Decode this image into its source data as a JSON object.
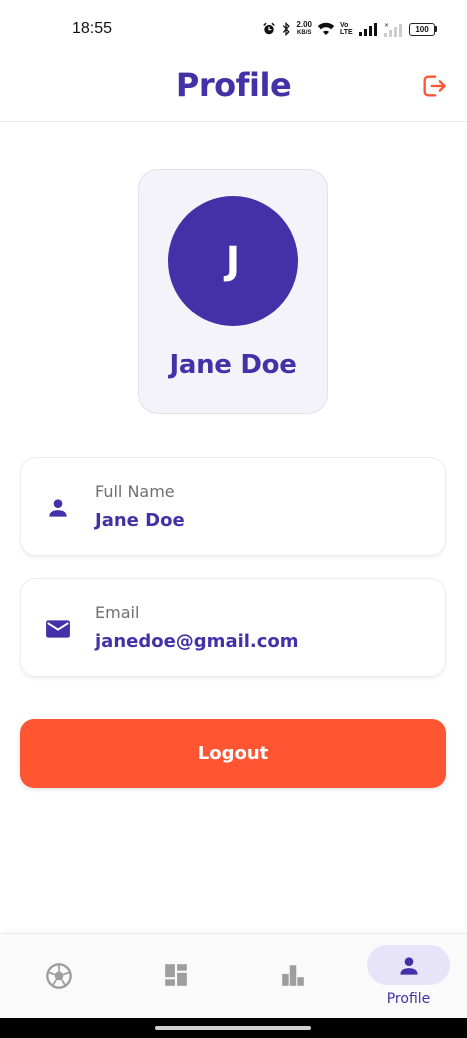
{
  "status_bar": {
    "time": "18:55",
    "net_speed": "2.00",
    "net_unit": "KB/S",
    "volte": "Vo LTE",
    "battery": "100"
  },
  "app_bar": {
    "title": "Profile"
  },
  "profile": {
    "initial": "J",
    "name": "Jane Doe"
  },
  "fields": {
    "full_name": {
      "label": "Full Name",
      "value": "Jane Doe",
      "icon": "person-icon"
    },
    "email": {
      "label": "Email",
      "value": "janedoe@gmail.com",
      "icon": "mail-icon"
    }
  },
  "logout_button": {
    "label": "Logout"
  },
  "bottom_nav": {
    "items": [
      {
        "icon": "soccer-ball-icon",
        "label": ""
      },
      {
        "icon": "dashboard-icon",
        "label": ""
      },
      {
        "icon": "bar-chart-icon",
        "label": ""
      },
      {
        "icon": "person-icon",
        "label": "Profile",
        "active": true
      }
    ]
  },
  "colors": {
    "primary": "#4431a7",
    "logout": "#ff5533",
    "card_bg": "#f5f3fa",
    "nav_active_pill": "#e7e3f8",
    "nav_inactive": "#9e9e9e"
  }
}
